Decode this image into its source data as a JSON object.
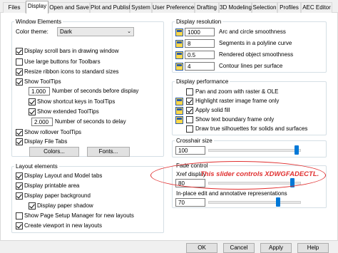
{
  "tabs": [
    "Files",
    "Display",
    "Open and Save",
    "Plot and Publish",
    "System",
    "User Preferences",
    "Drafting",
    "3D Modeling",
    "Selection",
    "Profiles",
    "AEC Editor"
  ],
  "window_elements": {
    "title": "Window Elements",
    "color_theme_label": "Color theme:",
    "color_theme_value": "Dark",
    "checkboxes": {
      "scroll_bars": "Display scroll bars in drawing window",
      "large_buttons": "Use large buttons for Toolbars",
      "resize_ribbon": "Resize ribbon icons to standard sizes",
      "show_tooltips": "Show ToolTips",
      "shortcut_keys": "Show shortcut keys in ToolTips",
      "extended_tooltips": "Show extended ToolTips",
      "rollover": "Show rollover ToolTips",
      "file_tabs": "Display File Tabs"
    },
    "seconds_before_value": "1.000",
    "seconds_before_label": "Number of seconds before display",
    "seconds_delay_value": "2.000",
    "seconds_delay_label": "Number of seconds to delay",
    "colors_button": "Colors...",
    "fonts_button": "Fonts..."
  },
  "layout_elements": {
    "title": "Layout elements",
    "items": {
      "layout_model_tabs": "Display Layout and Model tabs",
      "printable_area": "Display printable area",
      "paper_background": "Display paper background",
      "paper_shadow": "Display paper shadow",
      "page_setup": "Show Page Setup Manager for new layouts",
      "create_viewport": "Create viewport in new layouts"
    }
  },
  "display_resolution": {
    "title": "Display resolution",
    "items": [
      {
        "value": "1000",
        "label": "Arc and circle smoothness"
      },
      {
        "value": "8",
        "label": "Segments in a polyline curve"
      },
      {
        "value": "0.5",
        "label": "Rendered object smoothness"
      },
      {
        "value": "4",
        "label": "Contour lines per surface"
      }
    ]
  },
  "display_performance": {
    "title": "Display performance",
    "items": [
      "Pan and zoom with raster & OLE",
      "Highlight raster image frame only",
      "Apply solid fill",
      "Show text boundary frame only",
      "Draw true silhouettes for solids and surfaces"
    ]
  },
  "crosshair": {
    "title": "Crosshair size",
    "value": "100"
  },
  "fade_control": {
    "title": "Fade control",
    "xref_label": "Xref display",
    "xref_value": "80",
    "inplace_label": "In-place edit and annotative representations",
    "inplace_value": "70"
  },
  "annotation": {
    "text": "This slider controls XDWGFADECTL.",
    "color": "#e03030"
  },
  "buttons": {
    "ok": "OK",
    "cancel": "Cancel",
    "apply": "Apply",
    "help": "Help"
  },
  "colors": {
    "accent": "#0078d7",
    "group_border": "#d5dfe5"
  }
}
